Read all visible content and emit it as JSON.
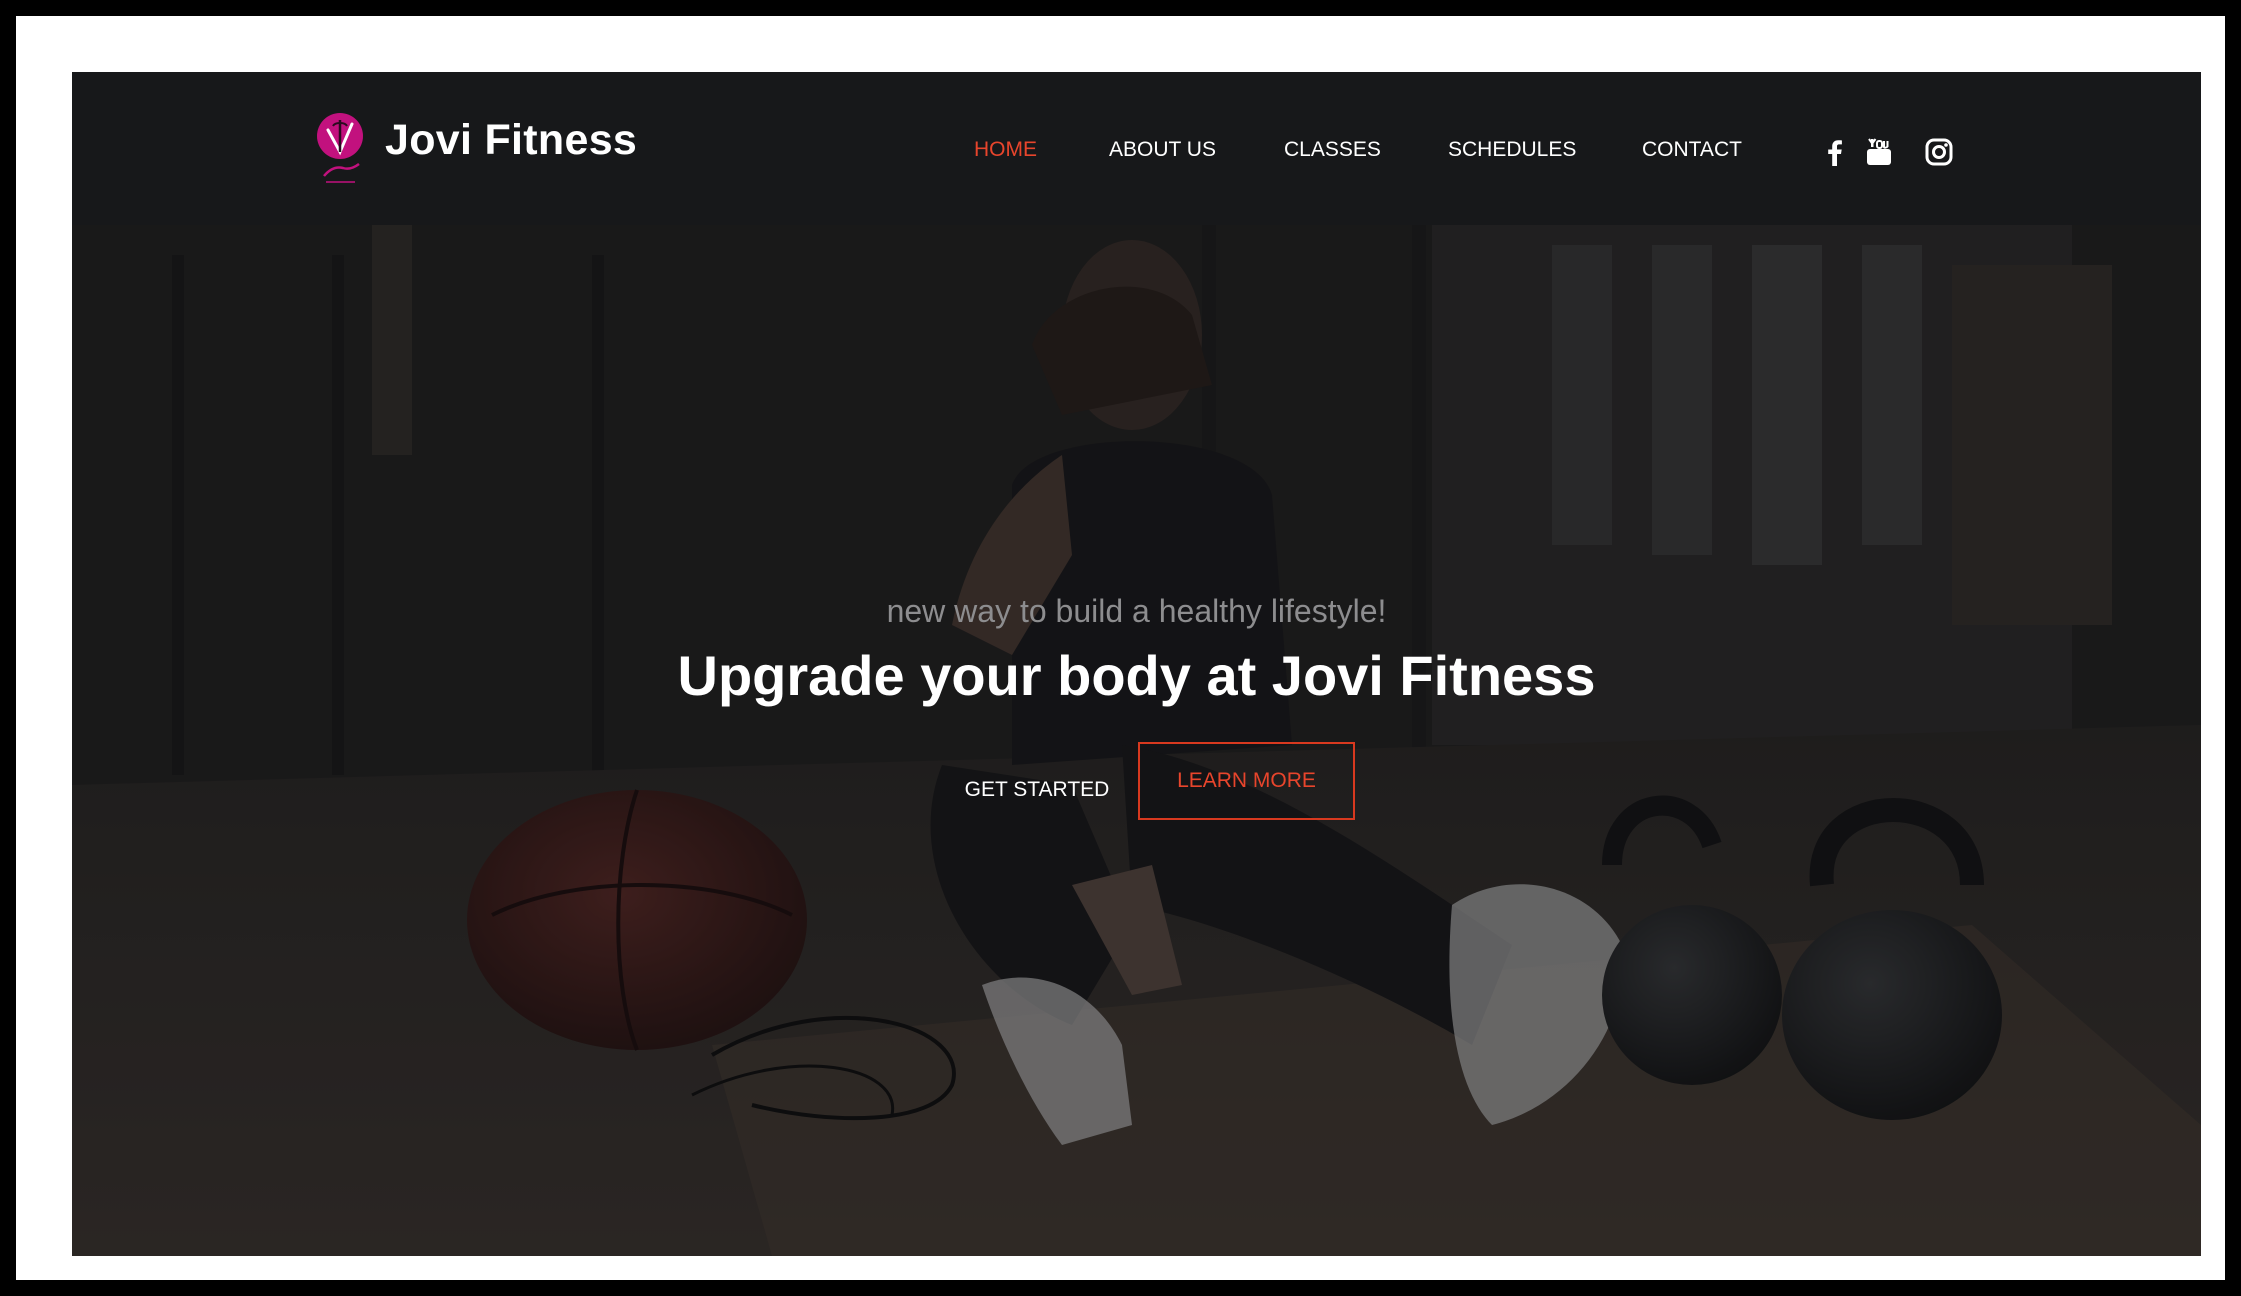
{
  "brand": {
    "name": "Jovi Fitness",
    "logo_text": "Jovi",
    "logo_color": "#c2117e"
  },
  "nav": {
    "items": [
      {
        "label": "HOME",
        "active": true
      },
      {
        "label": "ABOUT US",
        "active": false
      },
      {
        "label": "CLASSES",
        "active": false
      },
      {
        "label": "SCHEDULES",
        "active": false
      },
      {
        "label": "CONTACT",
        "active": false
      }
    ],
    "social": [
      "facebook-icon",
      "youtube-icon",
      "instagram-icon"
    ]
  },
  "hero": {
    "subtitle": "new way to build a healthy lifestyle!",
    "headline": "Upgrade your body at Jovi Fitness",
    "primary_button": "GET STARTED",
    "secondary_button": "LEARN MORE"
  },
  "colors": {
    "accent": "#e8452c",
    "header_bg": "#17181a",
    "text": "#ffffff"
  }
}
